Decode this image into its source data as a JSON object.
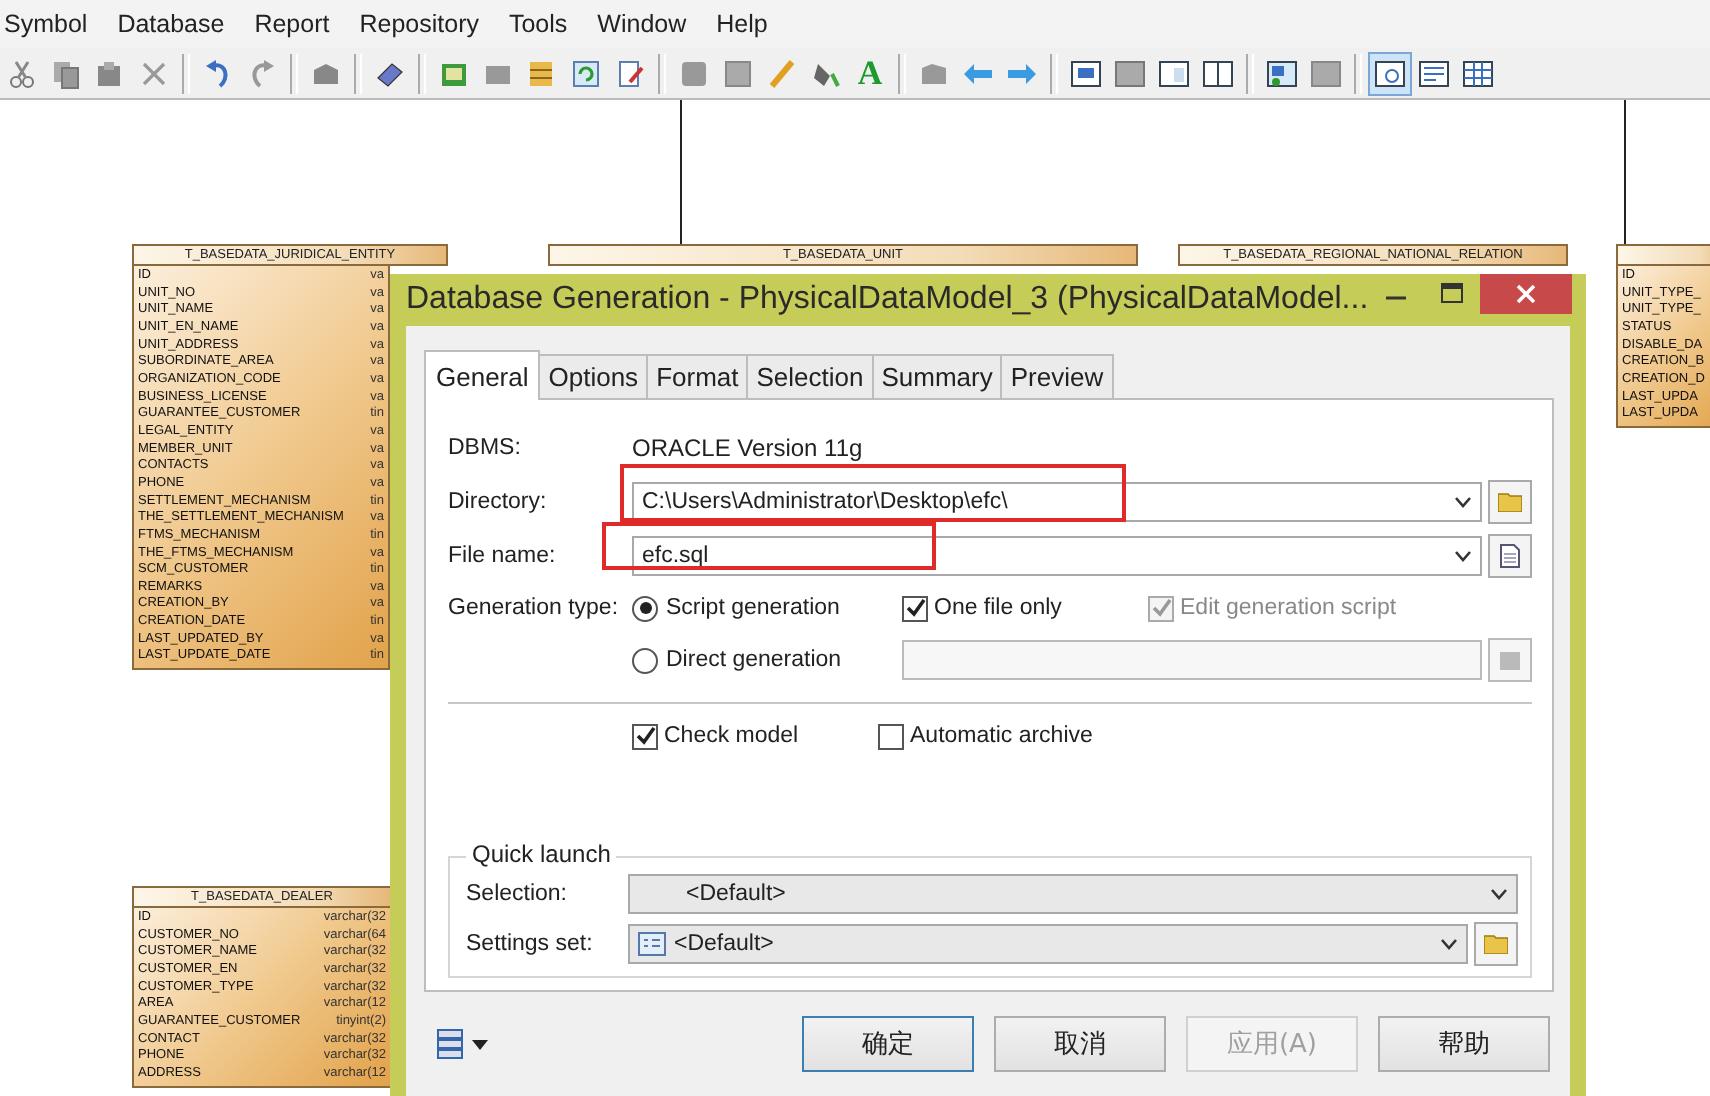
{
  "menu": [
    "Symbol",
    "Database",
    "Report",
    "Repository",
    "Tools",
    "Window",
    "Help"
  ],
  "toolbar": {
    "text_tool": "A"
  },
  "canvas": {
    "entities": [
      {
        "name": "T_BASEDATA_JURIDICAL_ENTITY",
        "rows": [
          {
            "name": "ID",
            "type": "va"
          },
          {
            "name": "UNIT_NO",
            "type": "va"
          },
          {
            "name": "UNIT_NAME",
            "type": "va"
          },
          {
            "name": "UNIT_EN_NAME",
            "type": "va"
          },
          {
            "name": "UNIT_ADDRESS",
            "type": "va"
          },
          {
            "name": "SUBORDINATE_AREA",
            "type": "va"
          },
          {
            "name": "ORGANIZATION_CODE",
            "type": "va"
          },
          {
            "name": "BUSINESS_LICENSE",
            "type": "va"
          },
          {
            "name": "GUARANTEE_CUSTOMER",
            "type": "tin"
          },
          {
            "name": "LEGAL_ENTITY",
            "type": "va"
          },
          {
            "name": "MEMBER_UNIT",
            "type": "va"
          },
          {
            "name": "CONTACTS",
            "type": "va"
          },
          {
            "name": "PHONE",
            "type": "va"
          },
          {
            "name": "SETTLEMENT_MECHANISM",
            "type": "tin"
          },
          {
            "name": "THE_SETTLEMENT_MECHANISM",
            "type": "va"
          },
          {
            "name": "FTMS_MECHANISM",
            "type": "tin"
          },
          {
            "name": "THE_FTMS_MECHANISM",
            "type": "va"
          },
          {
            "name": "SCM_CUSTOMER",
            "type": "tin"
          },
          {
            "name": "REMARKS",
            "type": "va"
          },
          {
            "name": "CREATION_BY",
            "type": "va"
          },
          {
            "name": "CREATION_DATE",
            "type": "tin"
          },
          {
            "name": "LAST_UPDATED_BY",
            "type": "va"
          },
          {
            "name": "LAST_UPDATE_DATE",
            "type": "tin"
          }
        ]
      },
      {
        "name": "T_BASEDATA_UNIT"
      },
      {
        "name": "T_BASEDATA_REGIONAL_NATIONAL_RELATION"
      },
      {
        "name": "T_BASEDATA_DEALER",
        "rows": [
          {
            "name": "ID",
            "type": "varchar(32"
          },
          {
            "name": "CUSTOMER_NO",
            "type": "varchar(64"
          },
          {
            "name": "CUSTOMER_NAME",
            "type": "varchar(32"
          },
          {
            "name": "CUSTOMER_EN",
            "type": "varchar(32"
          },
          {
            "name": "CUSTOMER_TYPE",
            "type": "varchar(32"
          },
          {
            "name": "AREA",
            "type": "varchar(12"
          },
          {
            "name": "GUARANTEE_CUSTOMER",
            "type": "tinyint(2)"
          },
          {
            "name": "CONTACT",
            "type": "varchar(32"
          },
          {
            "name": "PHONE",
            "type": "varchar(32"
          },
          {
            "name": "ADDRESS",
            "type": "varchar(12"
          }
        ]
      },
      {
        "rows": [
          {
            "name": "ID"
          },
          {
            "name": "UNIT_TYPE_"
          },
          {
            "name": "UNIT_TYPE_"
          },
          {
            "name": "STATUS"
          },
          {
            "name": "DISABLE_DA"
          },
          {
            "name": "CREATION_B"
          },
          {
            "name": "CREATION_D"
          },
          {
            "name": "LAST_UPDA"
          },
          {
            "name": "LAST_UPDA"
          }
        ]
      }
    ]
  },
  "dialog": {
    "title": "Database Generation - PhysicalDataModel_3 (PhysicalDataModel...",
    "tabs": [
      {
        "label": "General",
        "selected": true
      },
      {
        "label": "Options",
        "selected": false
      },
      {
        "label": "Format",
        "selected": false
      },
      {
        "label": "Selection",
        "selected": false
      },
      {
        "label": "Summary",
        "selected": false
      },
      {
        "label": "Preview",
        "selected": false
      }
    ],
    "dbms": {
      "label": "DBMS:",
      "value": "ORACLE Version 11g"
    },
    "directory": {
      "label": "Directory:",
      "value": "C:\\Users\\Administrator\\Desktop\\efc\\"
    },
    "file_name": {
      "label": "File name:",
      "value": "efc.sql"
    },
    "generation_type": {
      "label": "Generation type:",
      "options": [
        {
          "label": "Script generation",
          "selected": true
        },
        {
          "label": "Direct generation",
          "selected": false
        }
      ]
    },
    "one_file_only": {
      "label": "One file only",
      "checked": true,
      "disabled": false
    },
    "edit_generation_script": {
      "label": "Edit generation script",
      "checked": true,
      "disabled": true
    },
    "check_model": {
      "label": "Check model",
      "checked": true
    },
    "automatic_archive": {
      "label": "Automatic archive",
      "checked": false
    },
    "quick_launch": {
      "title": "Quick launch",
      "selection": {
        "label": "Selection:",
        "value": "<Default>"
      },
      "settings_set": {
        "label": "Settings set:",
        "value": "<Default>"
      }
    },
    "buttons": [
      {
        "label": "确定",
        "default": true,
        "disabled": false
      },
      {
        "label": "取消",
        "default": false,
        "disabled": false
      },
      {
        "label": "应用(A)",
        "default": false,
        "disabled": true
      },
      {
        "label": "帮助",
        "default": false,
        "disabled": false
      }
    ]
  }
}
